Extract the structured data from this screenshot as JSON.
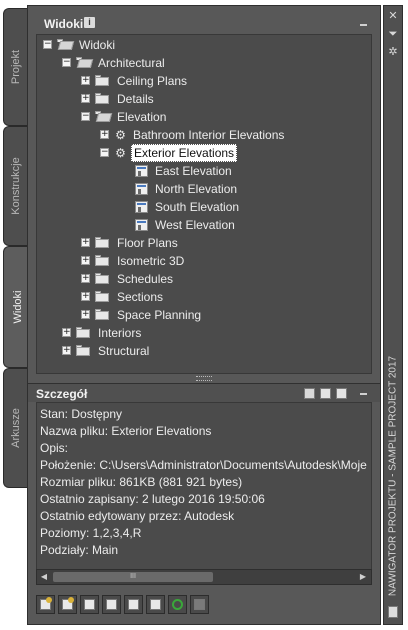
{
  "side_tabs": [
    "Projekt",
    "Konstrukcje",
    "Widoki",
    "Arkusze"
  ],
  "active_tab": "Widoki",
  "top_pane": {
    "title": "Widoki",
    "info_icon": "i"
  },
  "tree": [
    {
      "label": "Widoki",
      "toggle": "−",
      "icon": "folder-open-icon"
    },
    {
      "label": "Architectural",
      "toggle": "−",
      "icon": "folder-open-icon"
    },
    {
      "label": "Ceiling Plans",
      "toggle": "+",
      "icon": "folder-icon"
    },
    {
      "label": "Details",
      "toggle": "+",
      "icon": "folder-icon"
    },
    {
      "label": "Elevation",
      "toggle": "−",
      "icon": "folder-open-icon"
    },
    {
      "label": "Bathroom Interior Elevations",
      "toggle": "+",
      "icon": "gear-icon"
    },
    {
      "label": "Exterior Elevations",
      "toggle": "−",
      "icon": "gear-icon"
    },
    {
      "label": "East Elevation",
      "toggle": "",
      "icon": "view-icon"
    },
    {
      "label": "North Elevation",
      "toggle": "",
      "icon": "view-icon"
    },
    {
      "label": "South Elevation",
      "toggle": "",
      "icon": "view-icon"
    },
    {
      "label": "West Elevation",
      "toggle": "",
      "icon": "view-icon"
    },
    {
      "label": "Floor Plans",
      "toggle": "+",
      "icon": "folder-icon"
    },
    {
      "label": "Isometric 3D",
      "toggle": "+",
      "icon": "folder-icon"
    },
    {
      "label": "Schedules",
      "toggle": "+",
      "icon": "folder-icon"
    },
    {
      "label": "Sections",
      "toggle": "+",
      "icon": "folder-icon"
    },
    {
      "label": "Space Planning",
      "toggle": "+",
      "icon": "folder-icon"
    },
    {
      "label": "Interiors",
      "toggle": "+",
      "icon": "folder-icon"
    },
    {
      "label": "Structural",
      "toggle": "+",
      "icon": "folder-icon"
    }
  ],
  "selected_item": "Exterior Elevations",
  "detail_pane": {
    "title": "Szczegół",
    "lines": [
      "Stan: Dostępny",
      "Nazwa pliku: Exterior Elevations",
      "Opis:",
      "Położenie: C:\\Users\\Administrator\\Documents\\Autodesk\\Moje",
      "Rozmiar pliku: 861KB (881 921 bytes)",
      "Ostatnio zapisany: 2 lutego 2016  19:50:06",
      "Ostatnio edytowany przez: Autodesk",
      "Poziomy: 1,2,3,4,R",
      "Podziały: Main"
    ]
  },
  "scrollbar": {
    "left_arrow": "◀",
    "right_arrow": "▶",
    "thumb_grip": "III"
  },
  "toolbar_icons": [
    "new-view-icon",
    "new-folder-icon",
    "add-icon",
    "copy-icon",
    "link-icon",
    "properties-icon",
    "refresh-icon",
    "close-view-icon"
  ],
  "palette_title": "NAWIGATOR PROJEKTU - SAMPLE PROJECT 2017",
  "right_strip": {
    "close": "✕",
    "pin": "⏷",
    "settings": "✲",
    "collapse": "−"
  }
}
